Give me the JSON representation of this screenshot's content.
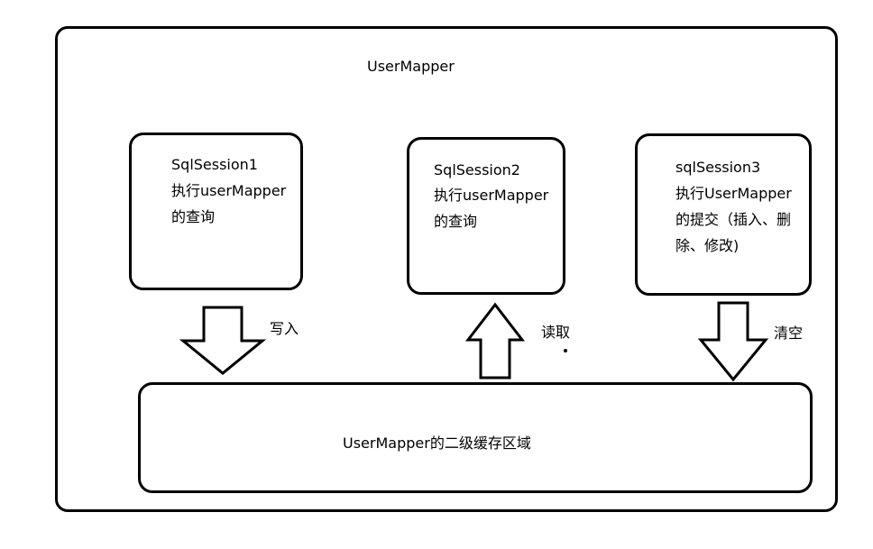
{
  "diagram": {
    "outer_title": "UserMapper",
    "sessions": [
      {
        "name": "SqlSession1",
        "lines": [
          "执行userMapper",
          "的查询"
        ]
      },
      {
        "name": "SqlSession2",
        "lines": [
          "执行userMapper",
          "的查询"
        ]
      },
      {
        "name": "sqlSession3",
        "lines": [
          "执行UserMapper",
          "的提交（插入、删",
          "除、修改)"
        ]
      }
    ],
    "edges": [
      {
        "label": "写入",
        "direction": "down"
      },
      {
        "label": "读取",
        "direction": "up"
      },
      {
        "label": "清空",
        "direction": "down"
      }
    ],
    "cache_label": "UserMapper的二级缓存区域"
  }
}
